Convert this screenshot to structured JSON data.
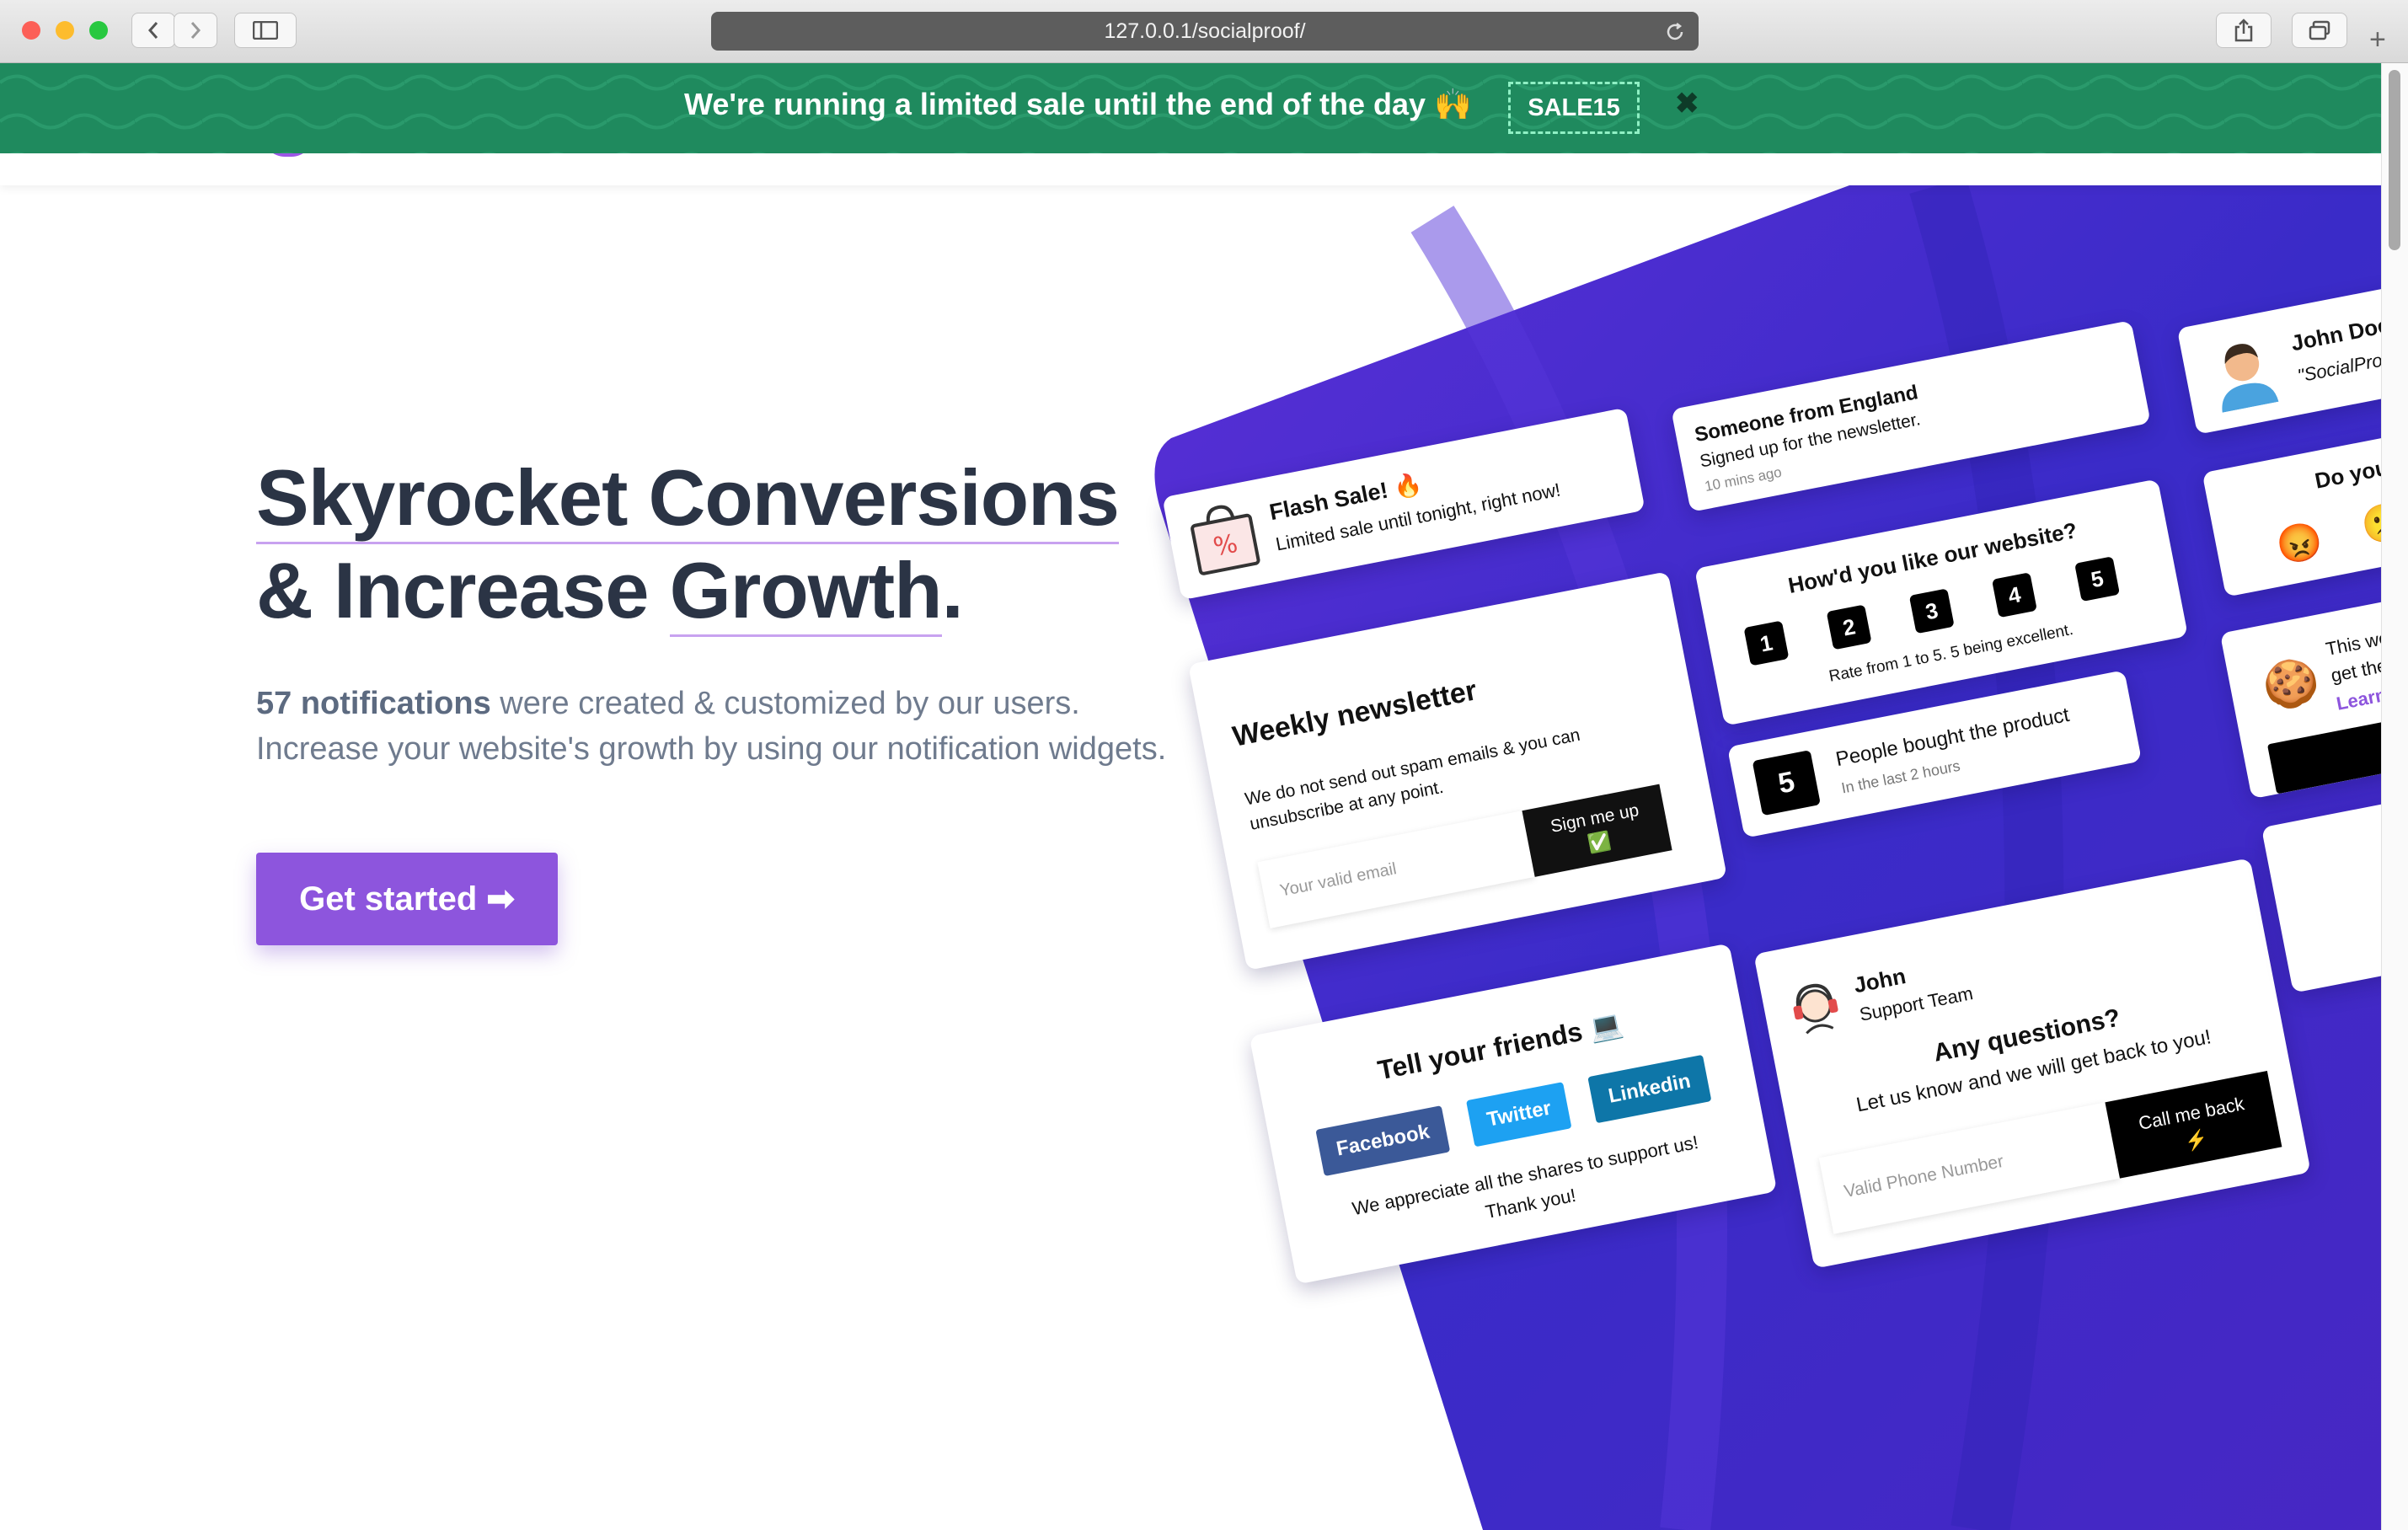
{
  "browser": {
    "url": "127.0.0.1/socialproof/"
  },
  "banner": {
    "message": "We're running a limited sale until the end of the day 🙌",
    "coupon": "SALE15",
    "close": "✖"
  },
  "hero": {
    "line1_a": "Skyrocket Conversions",
    "line2_a": "& Increase ",
    "line2_b": "Growth",
    "line2_c": ".",
    "sub_bold": "57 notifications",
    "sub_rest": " were created & customized by our users.",
    "sub_line2": "Increase your website's growth by using our notification widgets.",
    "cta": "Get started ➡"
  },
  "widgets": {
    "flash": {
      "title": "Flash Sale! 🔥",
      "text": "Limited sale until tonight, right now!"
    },
    "signup": {
      "title": "Someone from England",
      "text": "Signed up for the newsletter.",
      "time": "10 mins ago"
    },
    "review": {
      "name": "John Doe",
      "quote": "\"SocialPro"
    },
    "rating": {
      "title": "How'd you like our website?",
      "numbers": [
        "1",
        "2",
        "3",
        "4",
        "5"
      ],
      "caption": "Rate from 1 to 5. 5 being excellent."
    },
    "newsletter": {
      "title": "Weekly newsletter",
      "text": "We do not send out spam emails & you can unsubscribe at any point.",
      "placeholder": "Your valid email",
      "button": "Sign me up",
      "button_emoji": "✅"
    },
    "bought": {
      "count": "5",
      "title": "People bought the product",
      "sub": "In the last 2 hours"
    },
    "share": {
      "title": "Tell your friends 💻",
      "facebook": "Facebook",
      "twitter": "Twitter",
      "linkedin": "Linkedin",
      "thanks_1": "We appreciate all the shares to support us!",
      "thanks_2": "Thank you!"
    },
    "support": {
      "name": "John",
      "team": "Support Team",
      "question": "Any questions?",
      "text": "Let us know and we will get back to you!",
      "placeholder": "Valid Phone Number",
      "button": "Call me back",
      "button_emoji": "⚡"
    },
    "emoji_poll": {
      "title": "Do you"
    },
    "cookie": {
      "line1": "This we",
      "line2": "get the",
      "link": "Learn"
    }
  },
  "colors": {
    "banner": "#1f8a5e",
    "accent": "#8d55dd",
    "panel": "#4a2fd0",
    "heading": "#2b3445"
  }
}
